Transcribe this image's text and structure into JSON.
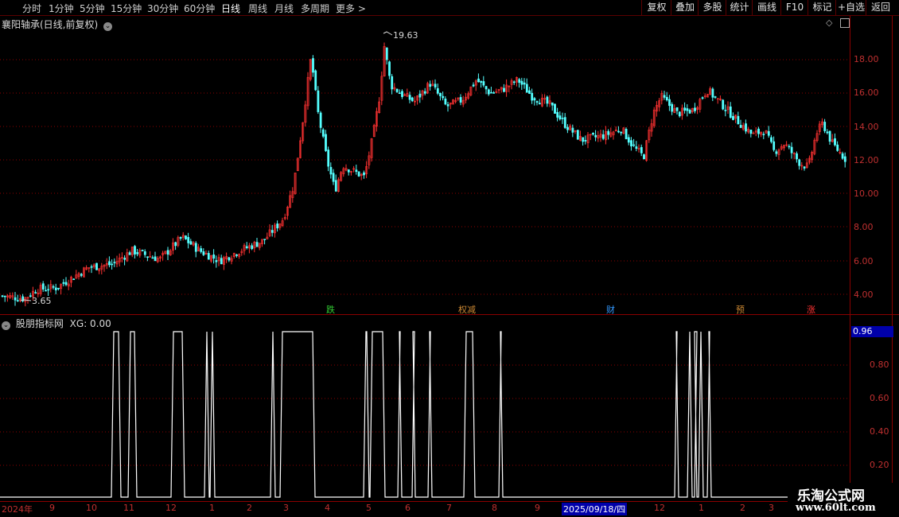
{
  "toolbar": {
    "periods": [
      "分时",
      "1分钟",
      "5分钟",
      "15分钟",
      "30分钟",
      "60分钟",
      "日线",
      "周线",
      "月线",
      "多周期",
      "更多 >"
    ],
    "active_period": "日线",
    "right_buttons": [
      "复权",
      "叠加",
      "多股",
      "统计",
      "画线",
      "F10",
      "标记",
      "+自选",
      "返回"
    ]
  },
  "price_panel": {
    "title": "襄阳轴承(日线,前复权)",
    "high_label": "19.63",
    "low_label": "3.65",
    "y_ticks": [
      "18.00",
      "16.00",
      "14.00",
      "12.00",
      "10.00",
      "8.00",
      "6.00",
      "4.00"
    ],
    "event_markers": [
      {
        "text": "跌",
        "color": "#33cc33"
      },
      {
        "text": "权减",
        "color": "#cc8833"
      },
      {
        "text": "财",
        "color": "#3399ff"
      },
      {
        "text": "预",
        "color": "#cc8833"
      },
      {
        "text": "涨",
        "color": "#ff3333"
      }
    ]
  },
  "indicator_panel": {
    "title": "股朋指标网",
    "xg_label": "XG: 0.00",
    "current_value": "0.96",
    "y_ticks": [
      "0.80",
      "0.60",
      "0.40",
      "0.20"
    ]
  },
  "date_axis": {
    "labels": [
      "2024年",
      "9",
      "10",
      "11",
      "12",
      "1",
      "2",
      "3",
      "4",
      "5",
      "6",
      "7",
      "8",
      "9",
      "2025/09/18/四",
      "12",
      "1",
      "2",
      "3"
    ]
  },
  "watermark": {
    "title": "乐淘公式网",
    "url": "www.60lt.com"
  },
  "colors": {
    "up": "#ff3232",
    "down": "#54ffff",
    "grid": "#8b0000",
    "signal": "#ffffff"
  }
}
